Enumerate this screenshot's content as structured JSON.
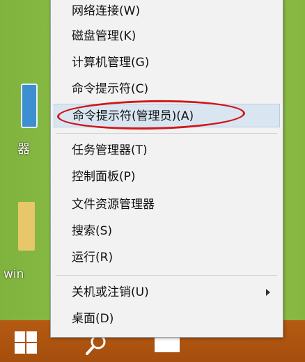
{
  "desktop": {
    "icon_label_1": "器",
    "icon_label_2": "win"
  },
  "menu": {
    "items": [
      {
        "label": "网络连接(W)"
      },
      {
        "label": "磁盘管理(K)"
      },
      {
        "label": "计算机管理(G)"
      },
      {
        "label": "命令提示符(C)"
      },
      {
        "label": "命令提示符(管理员)(A)"
      },
      {
        "label": "任务管理器(T)"
      },
      {
        "label": "控制面板(P)"
      },
      {
        "label": "文件资源管理器"
      },
      {
        "label": "搜索(S)"
      },
      {
        "label": "运行(R)"
      },
      {
        "label": "关机或注销(U)"
      },
      {
        "label": "桌面(D)"
      }
    ]
  },
  "annotation": {
    "color": "#d01818"
  },
  "taskbar": {
    "color": "#b45a12"
  },
  "icons": {
    "start": "windows-logo-icon",
    "search": "search-icon",
    "window": "window-icon",
    "submenu": "chevron-right-icon"
  }
}
